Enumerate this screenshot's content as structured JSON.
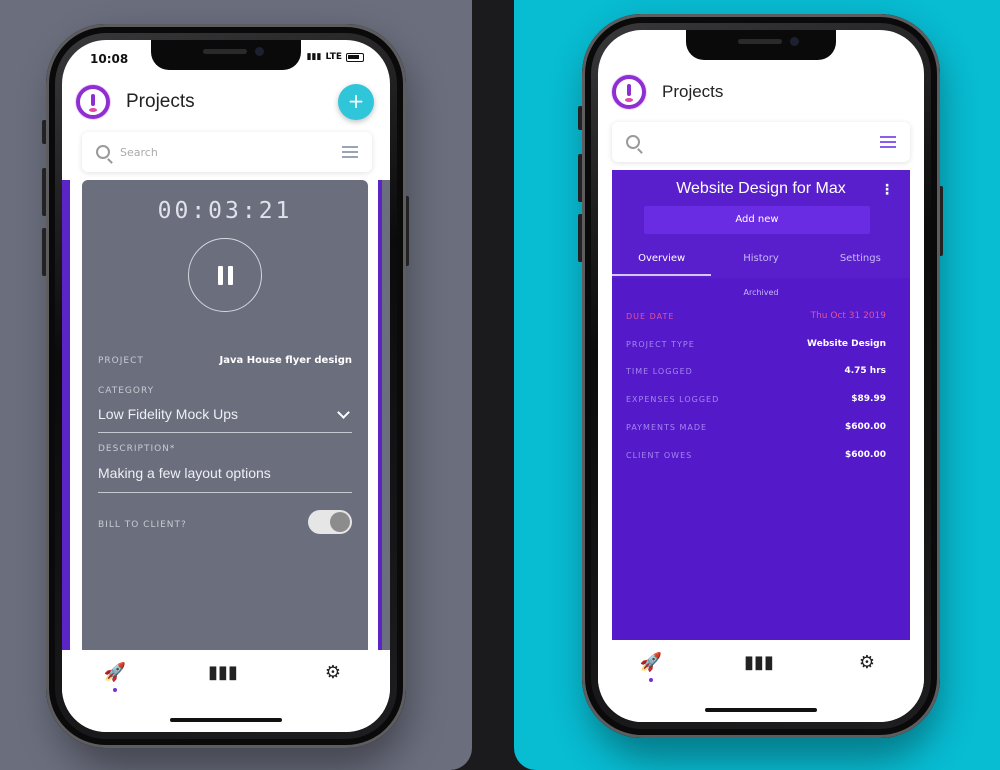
{
  "left": {
    "status": {
      "time": "10:08",
      "network": "LTE"
    },
    "header": {
      "title": "Projects",
      "fab_label": "+"
    },
    "search": {
      "placeholder": "Search"
    },
    "timer": {
      "value": "00:03:21"
    },
    "form": {
      "project_label": "PROJECT",
      "project_value": "Java House flyer design",
      "category_label": "CATEGORY",
      "category_value": "Low Fidelity Mock Ups",
      "description_label": "DESCRIPTION*",
      "description_value": "Making a few layout options",
      "bill_label": "BILL TO CLIENT?",
      "bill_enabled": true
    }
  },
  "right": {
    "header": {
      "title": "Projects"
    },
    "project": {
      "title": "Website Design for Max",
      "add_new": "Add new",
      "tabs": [
        {
          "label": "Overview",
          "active": true
        },
        {
          "label": "History",
          "active": false
        },
        {
          "label": "Settings",
          "active": false
        }
      ],
      "archived": "Archived",
      "rows": [
        {
          "label": "DUE DATE",
          "value": "Thu Oct 31 2019"
        },
        {
          "label": "PROJECT TYPE",
          "value": "Website Design"
        },
        {
          "label": "TIME LOGGED",
          "value": "4.75 hrs"
        },
        {
          "label": "EXPENSES LOGGED",
          "value": "$89.99"
        },
        {
          "label": "PAYMENTS MADE",
          "value": "$600.00"
        },
        {
          "label": "CLIENT OWES",
          "value": "$600.00"
        }
      ]
    }
  },
  "nav": {
    "items": [
      "rocket-icon",
      "bar-chart-icon",
      "gear-icon"
    ]
  },
  "colors": {
    "left_bg": "#6a6e7d",
    "right_bg": "#08bcd2",
    "brand_purple": "#5419c9",
    "accent_cyan": "#2ec6d8",
    "due_pink": "#e2539b"
  }
}
